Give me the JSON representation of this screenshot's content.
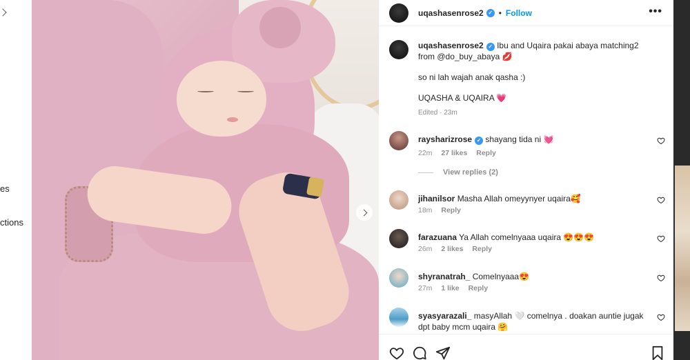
{
  "background": {
    "left_texts": [
      "es",
      "ctions"
    ]
  },
  "post": {
    "author": "uqashasenrose2",
    "follow_label": "Follow",
    "more_label": "•••",
    "caption": {
      "line1": "Ibu and Uqaira pakai abaya matching2",
      "line2": "from @do_buy_abaya 💋",
      "line3": "so ni lah wajah anak qasha :)",
      "line4": "UQASHA & UQAIRA 💗",
      "meta": "Edited · 23m"
    }
  },
  "comments": [
    {
      "user": "raysharizrose",
      "verified": true,
      "text": "shayang tida ni 💓",
      "time": "22m",
      "likes": "27 likes",
      "reply": "Reply",
      "avatar_color": "#6b3a3a"
    },
    {
      "user": "jihanilsor",
      "verified": false,
      "text": "Masha Allah omeyynyer uqaira🥰",
      "time": "18m",
      "likes": "",
      "reply": "Reply",
      "avatar_color": "#d8b9a6"
    },
    {
      "user": "farazuana",
      "verified": false,
      "text": "Ya Allah comelnyaaa uqaira 😍😍😍",
      "time": "26m",
      "likes": "2 likes",
      "reply": "Reply",
      "avatar_color": "#2b2b2b"
    },
    {
      "user": "shyranatrah_",
      "verified": false,
      "text": "Comelnyaaa😍",
      "time": "27m",
      "likes": "1 like",
      "reply": "Reply",
      "avatar_color": "#6fb6c9"
    },
    {
      "user": "syasyarazali_",
      "verified": false,
      "text": "masyAllah 🤍 comelnya . doakan auntie jugak",
      "text2": "dpt baby mcm uqaira 🤗",
      "time": "",
      "likes": "",
      "reply": "",
      "avatar_color": "#7fb8d6"
    }
  ],
  "view_replies": "View replies (2)",
  "colors": {
    "link": "#0095f6",
    "verified": "#3897f0",
    "muted": "#8e8e8e"
  },
  "icons": [
    "heart-icon",
    "comment-icon",
    "share-icon",
    "bookmark-icon",
    "next-arrow-icon",
    "more-icon"
  ]
}
